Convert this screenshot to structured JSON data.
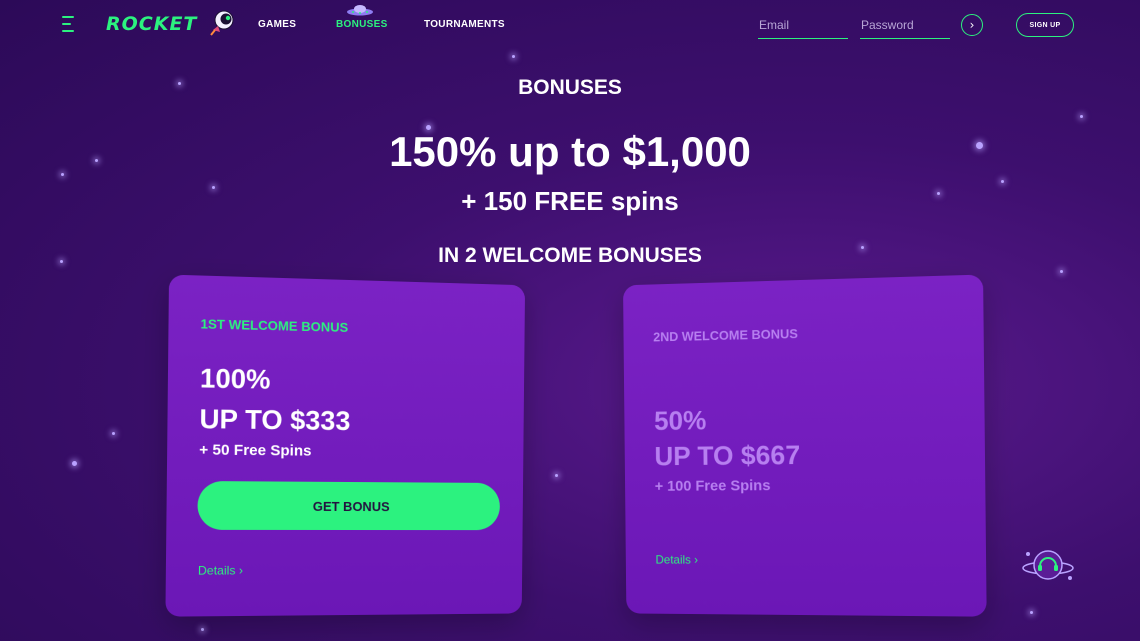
{
  "header": {
    "logo": "ROCKET",
    "nav": [
      "GAMES",
      "BONUSES",
      "TOURNAMENTS"
    ],
    "email_placeholder": "Email",
    "password_placeholder": "Password",
    "signup_label": "SIGN UP",
    "go_arrow": "›",
    "icons": [
      "menu-icon",
      "astronaut-logo-icon",
      "ufo-icon",
      "arrow-right-icon"
    ]
  },
  "hero": {
    "title": "BONUSES",
    "headline": "150% up to $1,000",
    "spins": "+ 150 FREE spins",
    "subtitle": "IN 2 WELCOME BONUSES"
  },
  "cards": [
    {
      "label": "1ST WELCOME BONUS",
      "percent": "100%",
      "amount": "UP TO $333",
      "spins": "+ 50 Free Spins",
      "button": "GET BONUS",
      "details": "Details ›"
    },
    {
      "label": "2ND WELCOME BONUS",
      "percent": "50%",
      "amount": "UP TO $667",
      "spins": "+ 100 Free Spins",
      "details": "Details ›"
    }
  ],
  "colors": {
    "accent": "#2cf27f",
    "background": "#3d0f6e",
    "card": "#7322bf",
    "muted": "#b77ff0"
  },
  "support_icon": "support-astronaut-icon"
}
